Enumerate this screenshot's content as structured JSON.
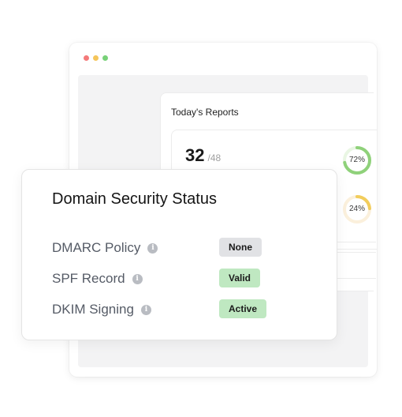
{
  "reports": {
    "title": "Today's Reports",
    "count": "32",
    "total": "/48",
    "rings": [
      {
        "label": "72%",
        "value": 0.72,
        "color": "#8fd17a"
      },
      {
        "label": "24%",
        "value": 0.24,
        "color": "#f2cd5c"
      }
    ]
  },
  "security": {
    "title": "Domain Security Status",
    "rows": [
      {
        "label": "DMARC Policy",
        "status": "None",
        "status_color": "#e1e2e5"
      },
      {
        "label": "SPF Record",
        "status": "Valid",
        "status_color": "#bfe8c1"
      },
      {
        "label": "DKIM Signing",
        "status": "Active",
        "status_color": "#bfe8c1"
      }
    ],
    "info_icon": "info-icon"
  }
}
